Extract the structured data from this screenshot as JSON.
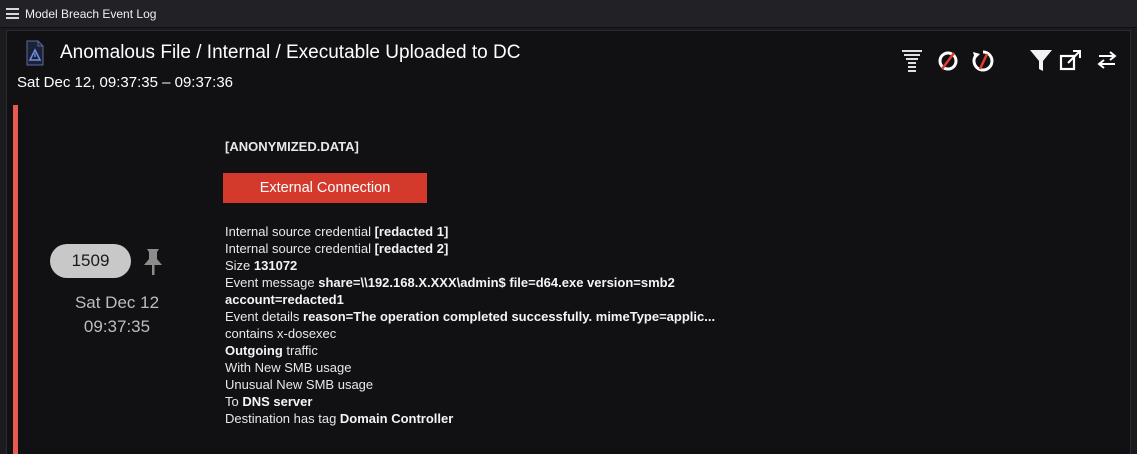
{
  "window": {
    "title": "Model Breach Event Log"
  },
  "event": {
    "title": "Anomalous File / Internal / Executable Uploaded to DC",
    "time_range": "Sat Dec 12, 09:37:35 – 09:37:36"
  },
  "toolbar": {
    "icons": [
      "stacked-filter-icon",
      "block-event-icon",
      "block-refresh-icon",
      "filter-icon",
      "popout-icon",
      "swap-icon"
    ]
  },
  "severity_color": "#e85a4f",
  "accent_color": "#d43a2c",
  "breach": {
    "count": "1509",
    "date": "Sat Dec 12",
    "time": "09:37:35"
  },
  "content": {
    "anonymized": "[ANONYMIZED.DATA]",
    "action_label": "External Connection",
    "lines": [
      {
        "text": "Internal source credential ",
        "bold": "[redacted 1]"
      },
      {
        "text": "Internal source credential ",
        "bold": "[redacted 2]"
      },
      {
        "text": "Size ",
        "bold": "131072"
      },
      {
        "text": "Event message ",
        "bold": "share=\\\\192.168.X.XXX\\admin$ file=d64.exe version=smb2"
      },
      {
        "text": "",
        "bold": "account=redacted1"
      },
      {
        "text": "Event details ",
        "bold": "reason=The operation completed successfully. mimeType=applic..."
      },
      {
        "text": "contains x-dosexec",
        "bold": ""
      },
      {
        "bold": "Outgoing",
        "text": " traffic",
        "bold_first": true
      },
      {
        "text": "With New SMB usage",
        "bold": ""
      },
      {
        "text": "Unusual New SMB usage",
        "bold": ""
      },
      {
        "text": "To ",
        "bold": "DNS server"
      },
      {
        "text": "Destination has tag ",
        "bold": "Domain Controller"
      }
    ]
  }
}
